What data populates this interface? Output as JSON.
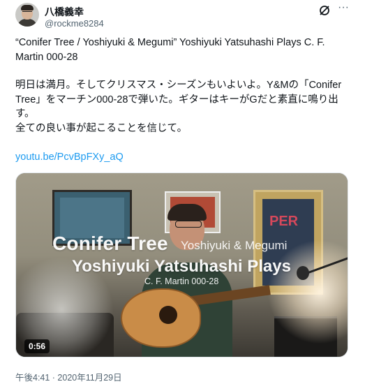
{
  "author": {
    "name": "八橋義幸",
    "handle": "@rockme8284"
  },
  "icons": {
    "grok": "grok-slash-icon",
    "more": "more-horizontal-icon"
  },
  "tweet": {
    "paragraphs": [
      "“Conifer Tree / Yoshiyuki & Megumi” Yoshiyuki Yatsuhashi Plays C. F. Martin 000-28",
      "明日は満月。そしてクリスマス・シーズンもいよいよ。Y&Mの「Conifer Tree」をマーチン000-28で弾いた。ギターはキーがGだと素直に鳴り出す。\n全ての良い事が起こることを信じて。"
    ],
    "link": "youtu.be/PcvBpFXy_aQ"
  },
  "media": {
    "overlay_title_main": "Conifer Tree",
    "overlay_title_sub": "Yoshiyuki & Megumi",
    "overlay_line2": "Yoshiyuki Yatsuhashi Plays",
    "overlay_line3": "C. F. Martin 000-28",
    "duration": "0:56",
    "poster_text": "PER"
  },
  "timestamp": "午後4:41 · 2020年11月29日",
  "colors": {
    "link": "#1d9bf0",
    "secondary_text": "#536471",
    "primary_text": "#0f1419"
  }
}
